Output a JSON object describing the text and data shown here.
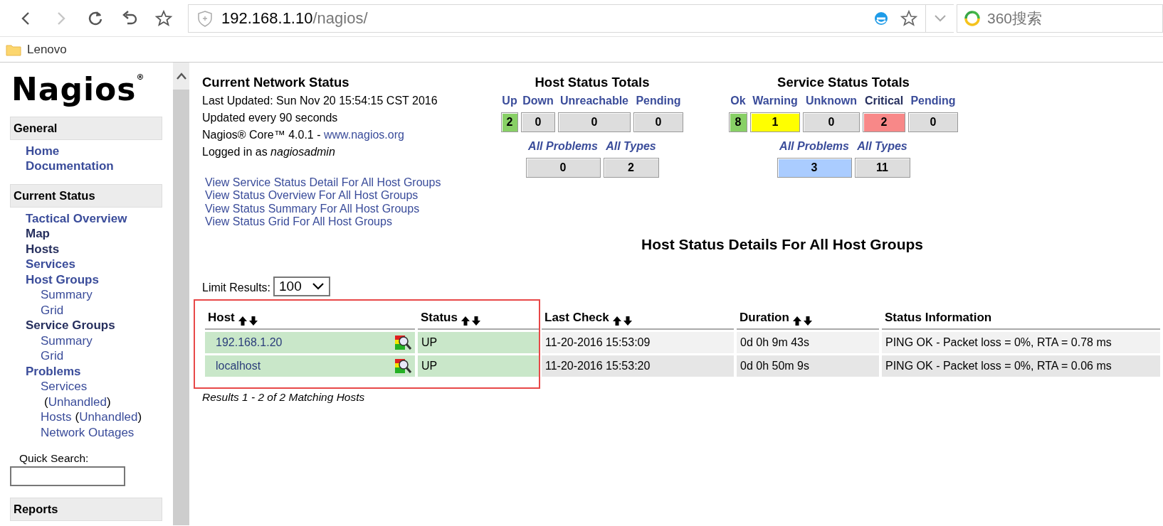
{
  "browser": {
    "url_host": "192.168.1.10",
    "url_path": "/nagios/",
    "search_placeholder": "360搜索",
    "bookmarks": [
      {
        "label": "Lenovo"
      }
    ]
  },
  "sidebar": {
    "logo": {
      "text": "Nagios",
      "mark": "®"
    },
    "sections": [
      {
        "title": "General",
        "items": [
          {
            "label": "Home",
            "visited": false
          },
          {
            "label": "Documentation",
            "visited": false
          }
        ]
      },
      {
        "title": "Current Status",
        "items": [
          {
            "label": "Tactical Overview",
            "visited": false
          },
          {
            "label": "Map",
            "visited": true
          },
          {
            "label": "Hosts",
            "visited": true
          },
          {
            "label": "Services",
            "visited": false
          },
          {
            "label": "Host Groups",
            "visited": false,
            "children": [
              {
                "parts": [
                  {
                    "text": "Summary",
                    "kind": "link"
                  }
                ]
              },
              {
                "parts": [
                  {
                    "text": "Grid",
                    "kind": "link"
                  }
                ]
              }
            ]
          },
          {
            "label": "Service Groups",
            "visited": true,
            "children": [
              {
                "parts": [
                  {
                    "text": "Summary",
                    "kind": "link"
                  }
                ]
              },
              {
                "parts": [
                  {
                    "text": "Grid",
                    "kind": "link"
                  }
                ]
              }
            ]
          },
          {
            "label": "Problems",
            "visited": false,
            "children": [
              {
                "parts": [
                  {
                    "text": "Services",
                    "kind": "link"
                  },
                  {
                    "text": "(",
                    "kind": "text"
                  },
                  {
                    "text": "Unhandled",
                    "kind": "link"
                  },
                  {
                    "text": ")",
                    "kind": "text"
                  }
                ]
              },
              {
                "parts": [
                  {
                    "text": "Hosts",
                    "kind": "link"
                  },
                  {
                    "text": "(",
                    "kind": "text"
                  },
                  {
                    "text": "Unhandled",
                    "kind": "link"
                  },
                  {
                    "text": ")",
                    "kind": "text"
                  }
                ]
              },
              {
                "parts": [
                  {
                    "text": "Network Outages",
                    "kind": "link"
                  }
                ]
              }
            ]
          }
        ]
      }
    ],
    "quick_search": {
      "label": "Quick Search:"
    },
    "next_section": {
      "title": "Reports"
    }
  },
  "status_info": {
    "title": "Current Network Status",
    "lines": [
      "Last Updated: Sun Nov 20 15:54:15 CST 2016",
      "Updated every 90 seconds"
    ],
    "version": {
      "text": "Nagios® Core™ 4.0.1 - ",
      "link": "www.nagios.org"
    },
    "login": "Logged in as *nagiosadmin*",
    "links": [
      "View Service Status Detail For All Host Groups",
      "View Status Overview For All Host Groups",
      "View Status Summary For All Host Groups",
      "View Status Grid For All Host Groups"
    ]
  },
  "host_totals": {
    "title": "Host Status Totals",
    "states": [
      {
        "label": "Up",
        "count": "2",
        "visited": false,
        "color": "#88d066"
      },
      {
        "label": "Down",
        "count": "0",
        "visited": false,
        "color": "#dddddd"
      },
      {
        "label": "Unreachable",
        "count": "0",
        "visited": false,
        "color": "#dddddd"
      },
      {
        "label": "Pending",
        "count": "0",
        "visited": false,
        "color": "#dddddd"
      }
    ],
    "summary": [
      {
        "label": "All Problems",
        "count": "0",
        "color": "#dddddd"
      },
      {
        "label": "All Types",
        "count": "2",
        "color": "#dddddd"
      }
    ]
  },
  "service_totals": {
    "title": "Service Status Totals",
    "states": [
      {
        "label": "Ok",
        "count": "8",
        "visited": false,
        "color": "#88d066"
      },
      {
        "label": "Warning",
        "count": "1",
        "visited": false,
        "color": "#ffff00"
      },
      {
        "label": "Unknown",
        "count": "0",
        "visited": false,
        "color": "#dddddd"
      },
      {
        "label": "Critical",
        "count": "2",
        "visited": true,
        "color": "#f88888"
      },
      {
        "label": "Pending",
        "count": "0",
        "visited": false,
        "color": "#dddddd"
      }
    ],
    "summary": [
      {
        "label": "All Problems",
        "count": "3",
        "color": "#aaccff"
      },
      {
        "label": "All Types",
        "count": "11",
        "color": "#dddddd"
      }
    ]
  },
  "details": {
    "title": "Host Status Details For All Host Groups",
    "limit": {
      "label": "Limit Results:",
      "value": "100"
    },
    "highlight": {
      "color": "#e84848"
    },
    "columns": [
      {
        "label": "Host",
        "sortable": true
      },
      {
        "label": "Status",
        "sortable": true
      },
      {
        "label": "Last Check",
        "sortable": true
      },
      {
        "label": "Duration",
        "sortable": true
      },
      {
        "label": "Status Information",
        "sortable": false
      }
    ],
    "rows": [
      {
        "host": "192.168.1.20",
        "status": "UP",
        "last_check": "11-20-2016 15:53:09",
        "duration": "0d 0h 9m 43s",
        "info": "PING OK - Packet loss = 0%, RTA = 0.78 ms"
      },
      {
        "host": "localhost",
        "status": "UP",
        "last_check": "11-20-2016 15:53:20",
        "duration": "0d 0h 50m 9s",
        "info": "PING OK - Packet loss = 0%, RTA = 0.06 ms"
      }
    ],
    "footer": "Results 1 - 2 of 2 Matching Hosts"
  }
}
